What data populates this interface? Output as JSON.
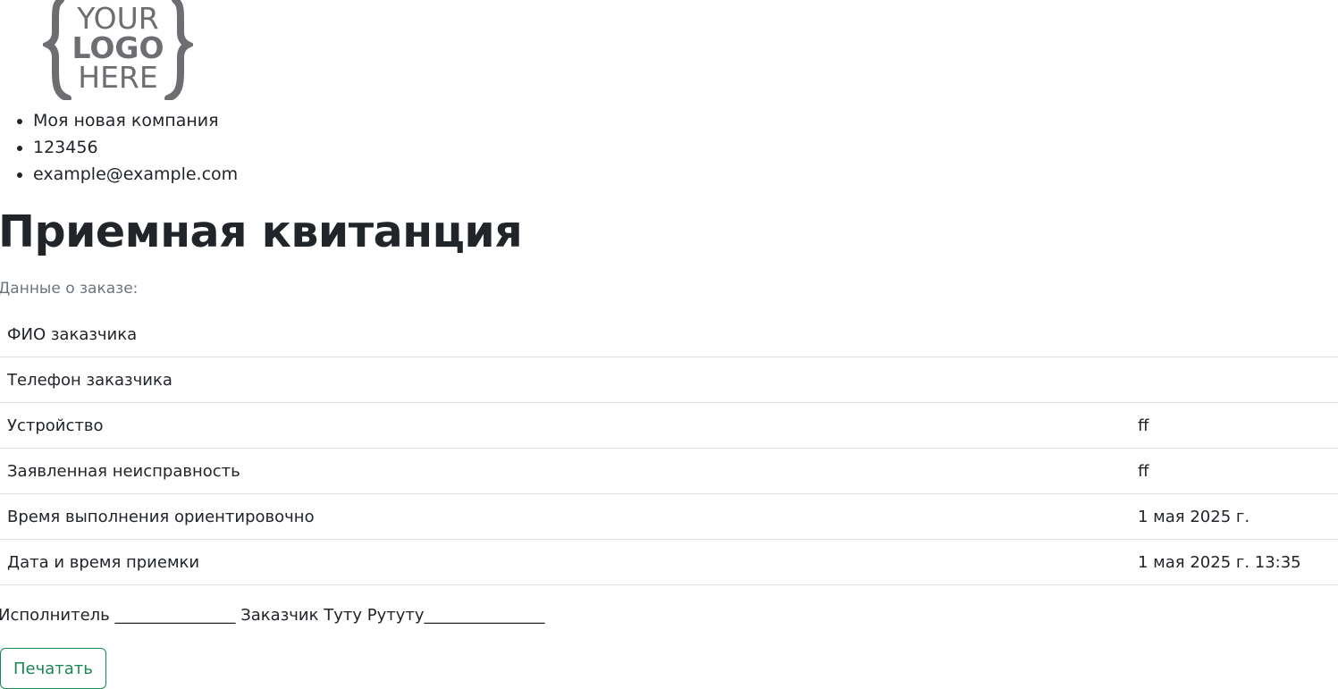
{
  "logo": {
    "line1": "YOUR",
    "line2": "LOGO",
    "line3": "HERE",
    "color": "#6d6e71"
  },
  "company": {
    "name": "Моя новая компания",
    "phone": "123456",
    "email": "example@example.com"
  },
  "page": {
    "title": "Приемная квитанция",
    "subtitle": "Данные о заказе:"
  },
  "order": {
    "rows": [
      {
        "label": "ФИО заказчика",
        "value": ""
      },
      {
        "label": "Телефон заказчика",
        "value": ""
      },
      {
        "label": "Устройство",
        "value": "ff"
      },
      {
        "label": "Заявленная неисправность",
        "value": "ff"
      },
      {
        "label": "Время выполнения ориентировочно",
        "value": "1 мая 2025 г."
      },
      {
        "label": "Дата и время приемки",
        "value": "1 мая 2025 г. 13:35"
      }
    ]
  },
  "signatures": {
    "text": "Исполнитель _______________ Заказчик Туту Рутуту_______________"
  },
  "actions": {
    "print_label": "Печатать"
  },
  "colors": {
    "accent": "#198754",
    "muted": "#6c757d",
    "border": "#dee2e6"
  }
}
